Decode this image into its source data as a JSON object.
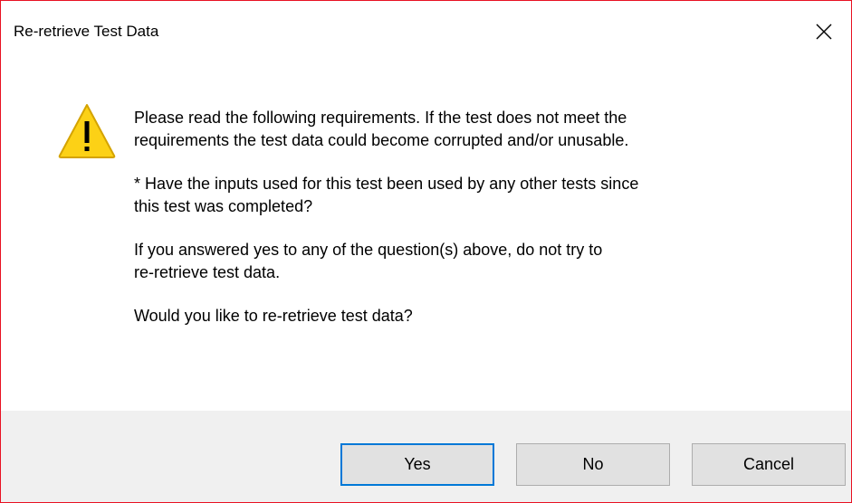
{
  "window": {
    "title": "Re-retrieve Test Data",
    "close_glyph": "✕",
    "close_icon": "close-icon",
    "accent_border_color": "#e81123"
  },
  "body": {
    "icon": "warning-icon",
    "icon_colors": {
      "fill": "#fcd116",
      "stroke": "#d4a300",
      "glyph": "#000000"
    },
    "paragraphs": [
      "Please read the following requirements.  If the test does not meet the\nrequirements the test data could become corrupted and/or unusable.",
      "* Have the inputs used for this test been used by any other tests since\nthis test was completed?",
      "If you answered yes to any of the question(s) above, do not try to\nre-retrieve test data.",
      "Would you like to re-retrieve test data?"
    ]
  },
  "buttons": {
    "yes": "Yes",
    "no": "No",
    "cancel": "Cancel",
    "default_border_color": "#0078d7"
  }
}
